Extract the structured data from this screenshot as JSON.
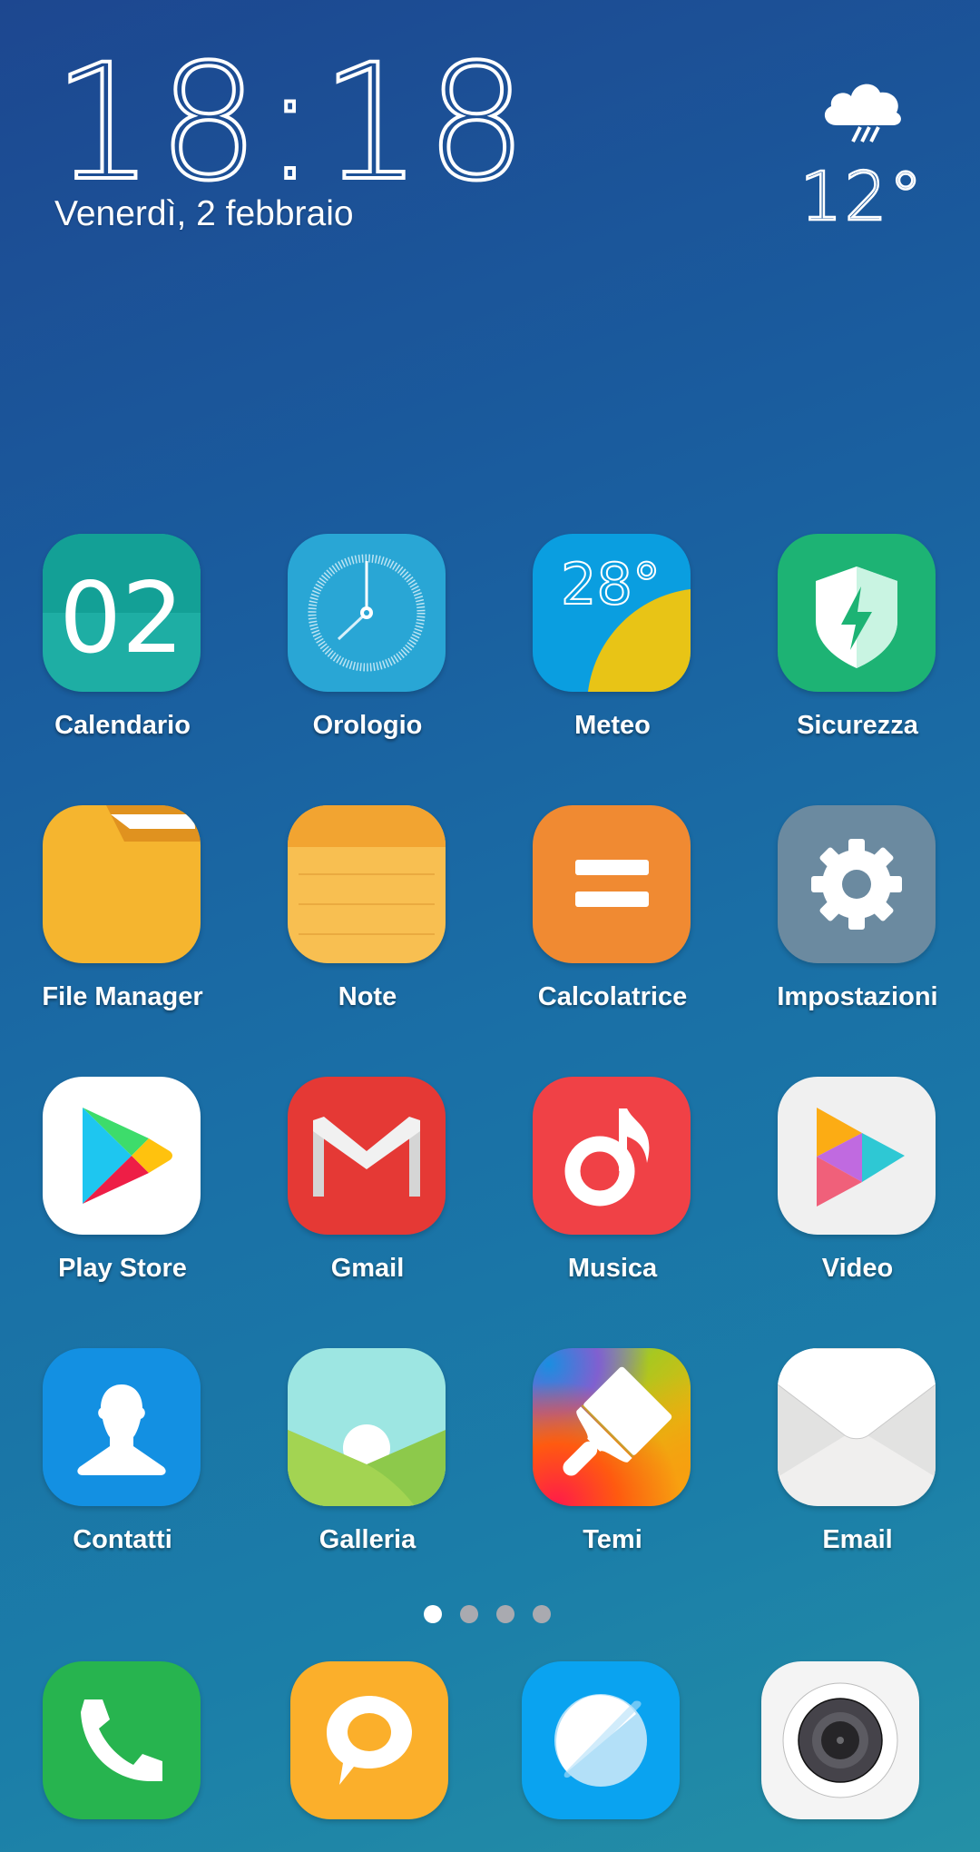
{
  "lockscreen_widget": {
    "time": "18:18",
    "date": "Venerdì, 2 febbraio",
    "weather_icon": "cloud-rain-icon",
    "temperature": "12°"
  },
  "apps": [
    {
      "label": "Calendario",
      "icon": "calendar-icon",
      "icon_text": "02",
      "color": "#1aa39a"
    },
    {
      "label": "Orologio",
      "icon": "clock-icon",
      "color": "#29a6d5"
    },
    {
      "label": "Meteo",
      "icon": "weather-sun-icon",
      "icon_text": "28°",
      "color": "#0a9ee0"
    },
    {
      "label": "Sicurezza",
      "icon": "shield-bolt-icon",
      "color": "#1db374"
    },
    {
      "label": "File Manager",
      "icon": "folder-icon",
      "color": "#f5b52f"
    },
    {
      "label": "Note",
      "icon": "notepad-icon",
      "color": "#f8bf51"
    },
    {
      "label": "Calcolatrice",
      "icon": "equals-icon",
      "color": "#f08a32"
    },
    {
      "label": "Impostazioni",
      "icon": "gear-icon",
      "color": "#6b8aa0"
    },
    {
      "label": "Play Store",
      "icon": "play-store-icon",
      "color": "#ffffff"
    },
    {
      "label": "Gmail",
      "icon": "gmail-m-icon",
      "color": "#e53935"
    },
    {
      "label": "Musica",
      "icon": "music-note-icon",
      "color": "#f04146"
    },
    {
      "label": "Video",
      "icon": "video-play-icon",
      "color": "#f0f0f0"
    },
    {
      "label": "Contatti",
      "icon": "contact-person-icon",
      "color": "#1390e2"
    },
    {
      "label": "Galleria",
      "icon": "gallery-landscape-icon",
      "color": "#9de6e2"
    },
    {
      "label": "Temi",
      "icon": "paint-brush-icon",
      "color": "#e06040"
    },
    {
      "label": "Email",
      "icon": "envelope-icon",
      "color": "#ffffff"
    }
  ],
  "page_indicator": {
    "total": 4,
    "current": 1
  },
  "dock": [
    {
      "name": "phone",
      "icon": "phone-icon",
      "color": "#27b44f"
    },
    {
      "name": "messages",
      "icon": "chat-bubble-icon",
      "color": "#fbaf2b"
    },
    {
      "name": "browser",
      "icon": "browser-planet-icon",
      "color": "#0aa3f0"
    },
    {
      "name": "camera",
      "icon": "camera-lens-icon",
      "color": "#f4f4f4"
    }
  ]
}
